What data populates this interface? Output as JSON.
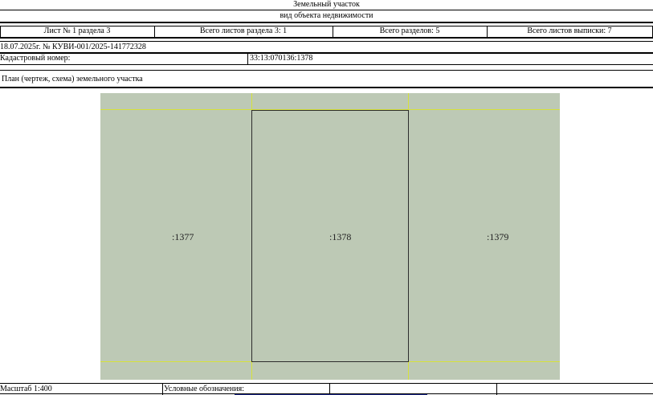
{
  "header": {
    "object_type": "Земельный участок",
    "property_kind": "вид объекта недвижимости"
  },
  "sheet_info": {
    "sheet": "Лист № 1 раздела 3",
    "sheets_in_section": "Всего листов раздела 3: 1",
    "total_sections": "Всего разделов: 5",
    "total_sheets": "Всего листов выписки: 7"
  },
  "statement": {
    "date_number": "18.07.2025г. № КУВИ-001/2025-141772328",
    "cadastral_label": "Кадастровый номер:",
    "cadastral_number": "33:13:070136:1378"
  },
  "plan": {
    "title": "План (чертеж, схема) земельного участка",
    "parcels": [
      ":1377",
      ":1378",
      ":1379"
    ],
    "fill_color": "#bdc9b5",
    "boundary_color": "#d6e13a"
  },
  "footer": {
    "scale": "Масштаб 1:400",
    "legend_label": "Условные обозначения:"
  }
}
